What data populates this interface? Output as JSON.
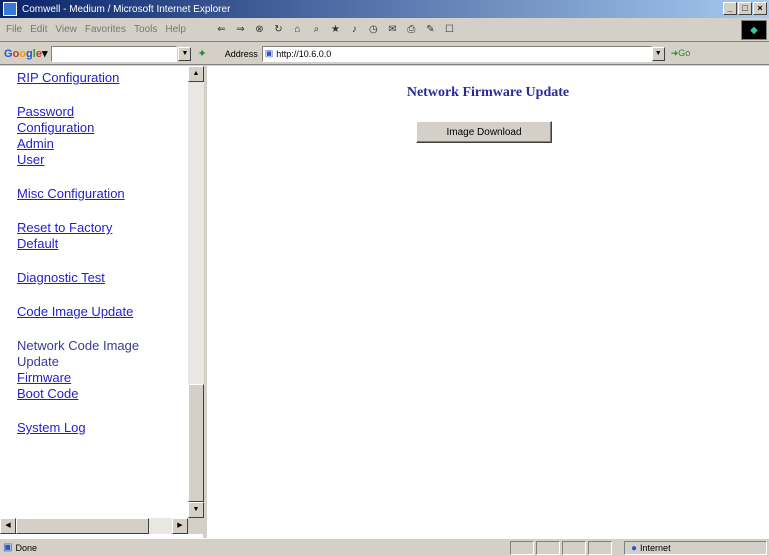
{
  "window": {
    "title": "Comwell - Medium / Microsoft Internet Explorer"
  },
  "menu": [
    "File",
    "Edit",
    "View",
    "Favorites",
    "Tools",
    "Help"
  ],
  "toolbar_icons": [
    "back-icon",
    "forward-icon",
    "stop-icon",
    "refresh-icon",
    "home-icon",
    "search-icon",
    "favorites-icon",
    "media-icon",
    "history-icon",
    "mail-icon",
    "print-icon",
    "edit-icon",
    "discuss-icon"
  ],
  "google_bar": {
    "logo": "Google",
    "search_value": ""
  },
  "address_bar": {
    "label": "Address",
    "url": "http://10.6.0.0",
    "go_label": "Go"
  },
  "nav": {
    "items": [
      {
        "label": "RIP Configuration"
      },
      {
        "label": "Password Configuration"
      },
      {
        "label": "Admin"
      },
      {
        "label": "User"
      },
      {
        "label": "Misc Configuration"
      },
      {
        "label": "Reset to Factory Default"
      },
      {
        "label": "Diagnostic Test"
      },
      {
        "label": "Code Image Update"
      },
      {
        "label": "Network Code Image Update"
      },
      {
        "label": "Firmware"
      },
      {
        "label": "Boot Code"
      },
      {
        "label": "System Log"
      }
    ]
  },
  "main": {
    "heading": "Network Firmware Update",
    "button_label": "Image Download"
  },
  "status_bar": {
    "text": "Done",
    "zone": "Internet"
  },
  "colors": {
    "link": "#1f1fd0",
    "heading": "#2a2aa0",
    "chrome": "#d4d0c8"
  }
}
